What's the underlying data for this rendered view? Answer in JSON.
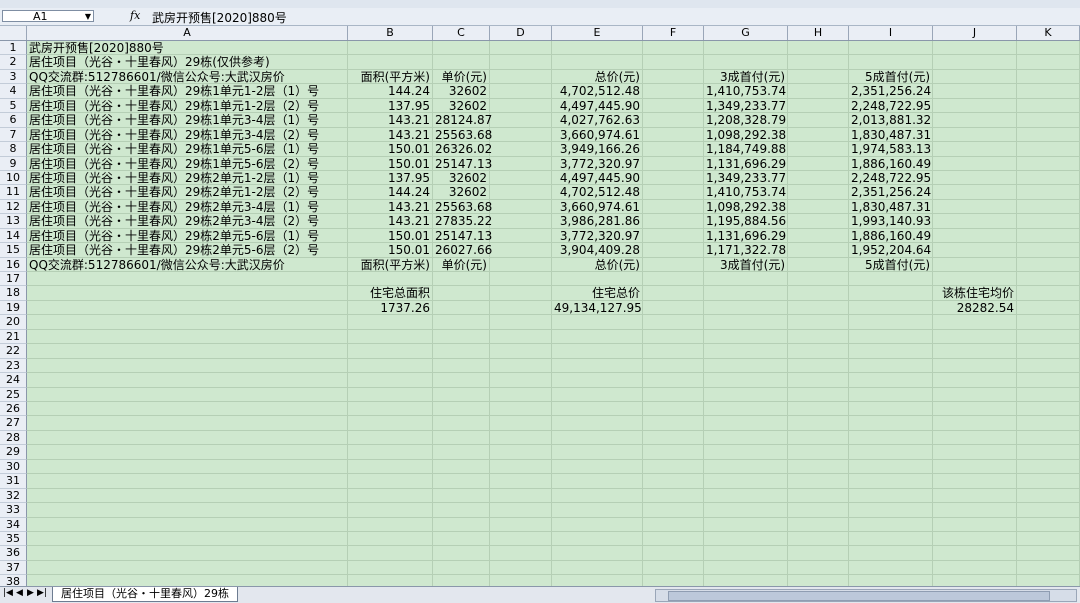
{
  "formula": {
    "cell_ref": "A1",
    "fx": "fx",
    "value": "武房开预售[2020]880号"
  },
  "columns": [
    "A",
    "B",
    "C",
    "D",
    "E",
    "F",
    "G",
    "H",
    "I",
    "J",
    "K"
  ],
  "rows": [
    {
      "n": "1",
      "A": "武房开预售[2020]880号"
    },
    {
      "n": "2",
      "A": "居住项目（光谷・十里春风）29栋(仅供参考)"
    },
    {
      "n": "3",
      "A": "QQ交流群:512786601/微信公众号:大武汉房价",
      "B": "面积(平方米)",
      "C": "单价(元)",
      "E": "总价(元)",
      "G": "3成首付(元)",
      "I": "5成首付(元)"
    },
    {
      "n": "4",
      "A": "居住项目（光谷・十里春风）29栋1单元1-2层（1）号",
      "B": "144.24",
      "C": "32602",
      "E": "4,702,512.48",
      "G": "1,410,753.74",
      "I": "2,351,256.24"
    },
    {
      "n": "5",
      "A": "居住项目（光谷・十里春风）29栋1单元1-2层（2）号",
      "B": "137.95",
      "C": "32602",
      "E": "4,497,445.90",
      "G": "1,349,233.77",
      "I": "2,248,722.95"
    },
    {
      "n": "6",
      "A": "居住项目（光谷・十里春风）29栋1单元3-4层（1）号",
      "B": "143.21",
      "C": "28124.87",
      "E": "4,027,762.63",
      "G": "1,208,328.79",
      "I": "2,013,881.32"
    },
    {
      "n": "7",
      "A": "居住项目（光谷・十里春风）29栋1单元3-4层（2）号",
      "B": "143.21",
      "C": "25563.68",
      "E": "3,660,974.61",
      "G": "1,098,292.38",
      "I": "1,830,487.31"
    },
    {
      "n": "8",
      "A": "居住项目（光谷・十里春风）29栋1单元5-6层（1）号",
      "B": "150.01",
      "C": "26326.02",
      "E": "3,949,166.26",
      "G": "1,184,749.88",
      "I": "1,974,583.13"
    },
    {
      "n": "9",
      "A": "居住项目（光谷・十里春风）29栋1单元5-6层（2）号",
      "B": "150.01",
      "C": "25147.13",
      "E": "3,772,320.97",
      "G": "1,131,696.29",
      "I": "1,886,160.49"
    },
    {
      "n": "10",
      "A": "居住项目（光谷・十里春风）29栋2单元1-2层（1）号",
      "B": "137.95",
      "C": "32602",
      "E": "4,497,445.90",
      "G": "1,349,233.77",
      "I": "2,248,722.95"
    },
    {
      "n": "11",
      "A": "居住项目（光谷・十里春风）29栋2单元1-2层（2）号",
      "B": "144.24",
      "C": "32602",
      "E": "4,702,512.48",
      "G": "1,410,753.74",
      "I": "2,351,256.24"
    },
    {
      "n": "12",
      "A": "居住项目（光谷・十里春风）29栋2单元3-4层（1）号",
      "B": "143.21",
      "C": "25563.68",
      "E": "3,660,974.61",
      "G": "1,098,292.38",
      "I": "1,830,487.31"
    },
    {
      "n": "13",
      "A": "居住项目（光谷・十里春风）29栋2单元3-4层（2）号",
      "B": "143.21",
      "C": "27835.22",
      "E": "3,986,281.86",
      "G": "1,195,884.56",
      "I": "1,993,140.93"
    },
    {
      "n": "14",
      "A": "居住项目（光谷・十里春风）29栋2单元5-6层（1）号",
      "B": "150.01",
      "C": "25147.13",
      "E": "3,772,320.97",
      "G": "1,131,696.29",
      "I": "1,886,160.49"
    },
    {
      "n": "15",
      "A": "居住项目（光谷・十里春风）29栋2单元5-6层（2）号",
      "B": "150.01",
      "C": "26027.66",
      "E": "3,904,409.28",
      "G": "1,171,322.78",
      "I": "1,952,204.64"
    },
    {
      "n": "16",
      "A": "QQ交流群:512786601/微信公众号:大武汉房价",
      "B": "面积(平方米)",
      "C": "单价(元)",
      "E": "总价(元)",
      "G": "3成首付(元)",
      "I": "5成首付(元)"
    },
    {
      "n": "17"
    },
    {
      "n": "18",
      "B": "住宅总面积",
      "E": "住宅总价",
      "J": "该栋住宅均价"
    },
    {
      "n": "19",
      "B": "1737.26",
      "E": "49,134,127.95",
      "J": "28282.54"
    },
    {
      "n": "20"
    },
    {
      "n": "21"
    },
    {
      "n": "22"
    },
    {
      "n": "23"
    },
    {
      "n": "24"
    },
    {
      "n": "25"
    },
    {
      "n": "26"
    },
    {
      "n": "27"
    },
    {
      "n": "28"
    },
    {
      "n": "29"
    },
    {
      "n": "30"
    },
    {
      "n": "31"
    },
    {
      "n": "32"
    },
    {
      "n": "33"
    },
    {
      "n": "34"
    },
    {
      "n": "35"
    },
    {
      "n": "36"
    },
    {
      "n": "37"
    },
    {
      "n": "38"
    }
  ],
  "sheet_tab": "居住项目（光谷・十里春风）29栋",
  "nav_icons": [
    "first-sheet-icon",
    "prev-sheet-icon",
    "next-sheet-icon",
    "last-sheet-icon"
  ],
  "nav_glyphs": [
    "|◀",
    "◀",
    "▶",
    "▶|"
  ]
}
